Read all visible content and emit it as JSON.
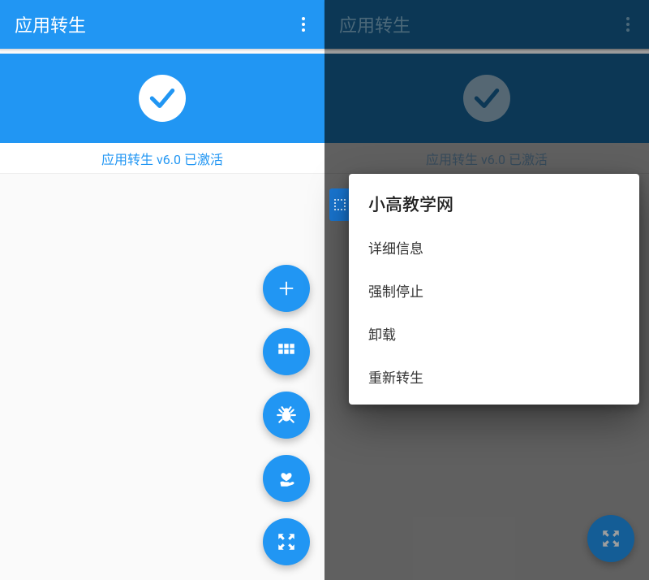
{
  "left": {
    "appTitle": "应用转生",
    "statusText": "应用转生 v6.0 已激活",
    "fabs": [
      {
        "name": "fab-add",
        "icon": "plus"
      },
      {
        "name": "fab-grid",
        "icon": "grid"
      },
      {
        "name": "fab-bug",
        "icon": "bug"
      },
      {
        "name": "fab-heart",
        "icon": "heart-hand"
      },
      {
        "name": "fab-expand",
        "icon": "expand"
      }
    ]
  },
  "right": {
    "appTitle": "应用转生",
    "statusText": "应用转生 v6.0 已激活",
    "dialog": {
      "title": "小高教学网",
      "items": [
        "详细信息",
        "强制停止",
        "卸载",
        "重新转生"
      ]
    }
  }
}
